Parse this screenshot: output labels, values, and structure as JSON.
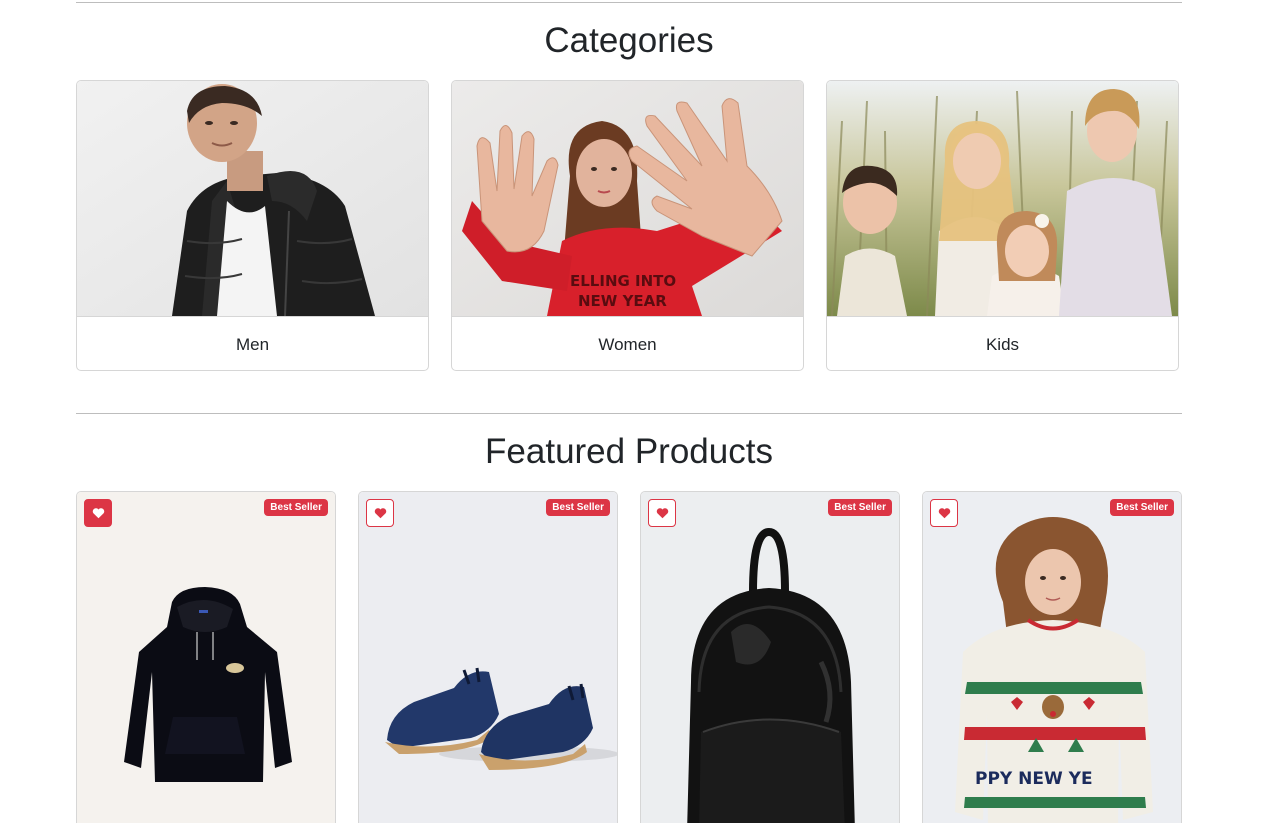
{
  "categories": {
    "title": "Categories",
    "items": [
      {
        "label": "Men",
        "image": "man-in-black-puffer-jacket"
      },
      {
        "label": "Women",
        "image": "woman-in-red-sweater"
      },
      {
        "label": "Kids",
        "image": "children-in-field"
      }
    ]
  },
  "featured": {
    "title": "Featured Products",
    "products": [
      {
        "badge": "Best Seller",
        "favorited": true,
        "image": "black-hoodie",
        "bg": "#f5f2ee"
      },
      {
        "badge": "Best Seller",
        "favorited": false,
        "image": "navy-suede-espadrilles",
        "bg": "#ecedf1"
      },
      {
        "badge": "Best Seller",
        "favorited": false,
        "image": "black-leather-backpack",
        "bg": "#eceef0"
      },
      {
        "badge": "Best Seller",
        "favorited": false,
        "image": "christmas-knit-sweater",
        "bg": "#eceef2"
      }
    ]
  },
  "colors": {
    "accent": "#dc3545",
    "border": "#d6d6d6",
    "rule": "#bdbdbd"
  },
  "icons": {
    "favorite": "heart-icon"
  }
}
